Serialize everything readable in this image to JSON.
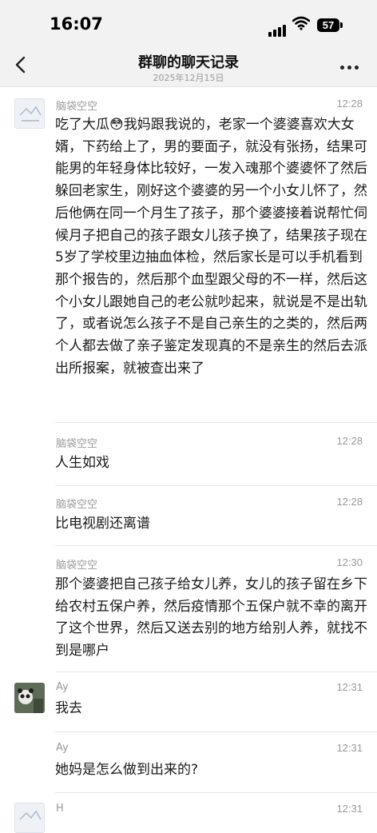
{
  "status_bar": {
    "time": "16:07",
    "battery": "57"
  },
  "nav": {
    "title": "群聊的聊天记录",
    "subtitle": "2025年12月15日"
  },
  "messages": [
    {
      "sender": "脑袋空空",
      "time": "12:28",
      "avatar": "logo-avatar",
      "text": "吃了大瓜😳我妈跟我说的，老家一个婆婆喜欢大女婿，下药给上了，男的要面子，就没有张扬，结果可能男的年轻身体比较好，一发入魂那个婆婆怀了然后躲回老家生，刚好这个婆婆的另一个小女儿怀了，然后他俩在同一个月生了孩子，那个婆婆接着说帮忙伺候月子把自己的孩子跟女儿孩子换了，结果孩子现在5岁了学校里边抽血体检，然后家长是可以手机看到那个报告的，然后那个血型跟父母的不一样，然后这个小女儿跟她自己的老公就吵起来，就说是不是出轨了，或者说怎么孩子不是自己亲生的之类的，然后两个人都去做了亲子鉴定发现真的不是亲生的然后去派出所报案，就被查出来了"
    },
    {
      "sender": "脑袋空空",
      "time": "12:28",
      "text": "人生如戏"
    },
    {
      "sender": "脑袋空空",
      "time": "12:28",
      "text": "比电视剧还离谱"
    },
    {
      "sender": "脑袋空空",
      "time": "12:30",
      "text": "那个婆婆把自己孩子给女儿养，女儿的孩子留在乡下给农村五保户养，然后疫情那个五保户就不幸的离开了这个世界，然后又送去别的地方给别人养，就找不到是哪户"
    },
    {
      "sender": "Ay",
      "time": "12:31",
      "avatar": "panda-avatar",
      "text": "我去"
    },
    {
      "sender": "Ay",
      "time": "12:31",
      "text": "她妈是怎么做到出来的?"
    },
    {
      "sender": "H",
      "time": "12:31",
      "avatar": "logo-avatar",
      "text": ""
    }
  ]
}
